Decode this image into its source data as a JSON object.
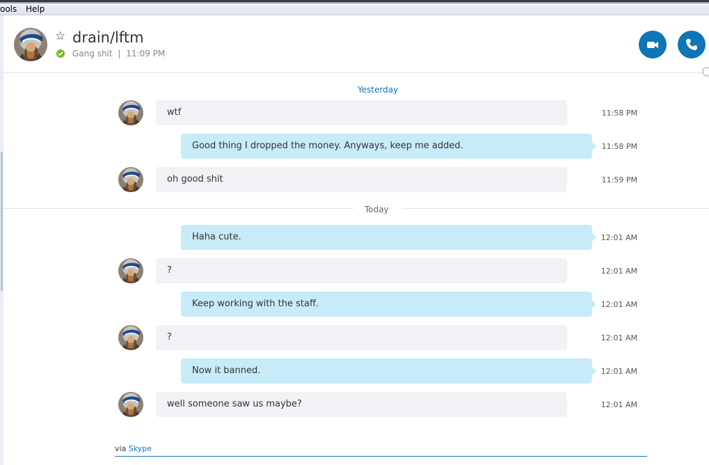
{
  "menu": {
    "items": [
      "ools",
      "Help"
    ]
  },
  "header": {
    "contact_name": "drain/lftm",
    "mood": "Gang shit",
    "separator": "|",
    "time": "11:09 PM",
    "icons": {
      "favorite": "star-outline-icon",
      "presence": "online-check-icon",
      "video": "video-camera-icon",
      "call": "phone-icon"
    }
  },
  "days": {
    "yesterday": "Yesterday",
    "today": "Today"
  },
  "messages": [
    {
      "direction": "in",
      "text": "wtf",
      "time": "11:58 PM"
    },
    {
      "direction": "out",
      "text": "Good thing I dropped the money. Anyways, keep me added.",
      "time": "11:58 PM"
    },
    {
      "direction": "in",
      "text": "oh good shit",
      "time": "11:59 PM"
    },
    {
      "direction": "out",
      "text": "Haha cute.",
      "time": "12:01 AM"
    },
    {
      "direction": "in",
      "text": "?",
      "time": "12:01 AM"
    },
    {
      "direction": "out",
      "text": "Keep working with the staff.",
      "time": "12:01 AM"
    },
    {
      "direction": "in",
      "text": "?",
      "time": "12:01 AM"
    },
    {
      "direction": "out",
      "text": "Now it banned.",
      "time": "12:01 AM"
    },
    {
      "direction": "in",
      "text": "well someone saw us maybe?",
      "time": "12:01 AM"
    }
  ],
  "footer": {
    "via": "via",
    "via_link": "Skype"
  },
  "colors": {
    "accent": "#0e75b6",
    "outgoing_bubble": "#c7ebf9",
    "incoming_bubble": "#f0f2f5",
    "online": "#7cb82f"
  }
}
